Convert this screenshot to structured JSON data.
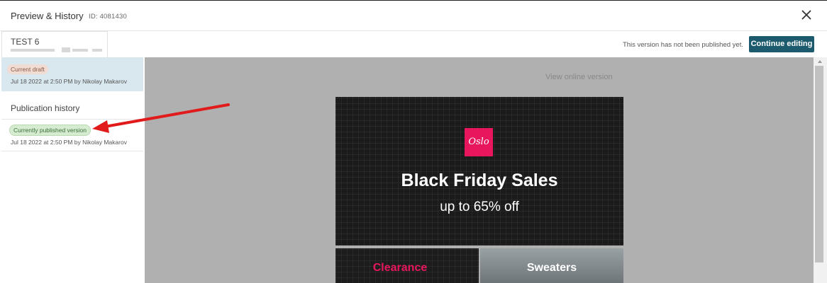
{
  "header": {
    "title": "Preview & History",
    "id_label": "ID: 4081430"
  },
  "template": {
    "name": "TEST 6"
  },
  "status_note": "This version has not been published yet.",
  "continue_button": "Continue editing",
  "draft": {
    "badge": "Current draft",
    "meta": "Jul 18 2022 at 2:50 PM by Nikolay Makarov"
  },
  "publication_history": {
    "heading": "Publication history",
    "items": [
      {
        "badge": "Currently published version",
        "meta": "Jul 18 2022 at 2:50 PM by Nikolay Makarov"
      }
    ]
  },
  "preview": {
    "view_online": "View online version",
    "email": {
      "logo_text": "Oslo",
      "headline": "Black Friday Sales",
      "subheadline": "up to 65% off",
      "tiles": [
        "Clearance",
        "Sweaters"
      ]
    }
  },
  "colors": {
    "accent_button": "#1c5b6e",
    "brand_pink": "#e8175d",
    "draft_bg": "#d8e8ee",
    "annotation_arrow": "#e11b1b"
  },
  "icons": {
    "close": "close-icon",
    "scroll_up": "scroll-up-arrow-icon"
  }
}
